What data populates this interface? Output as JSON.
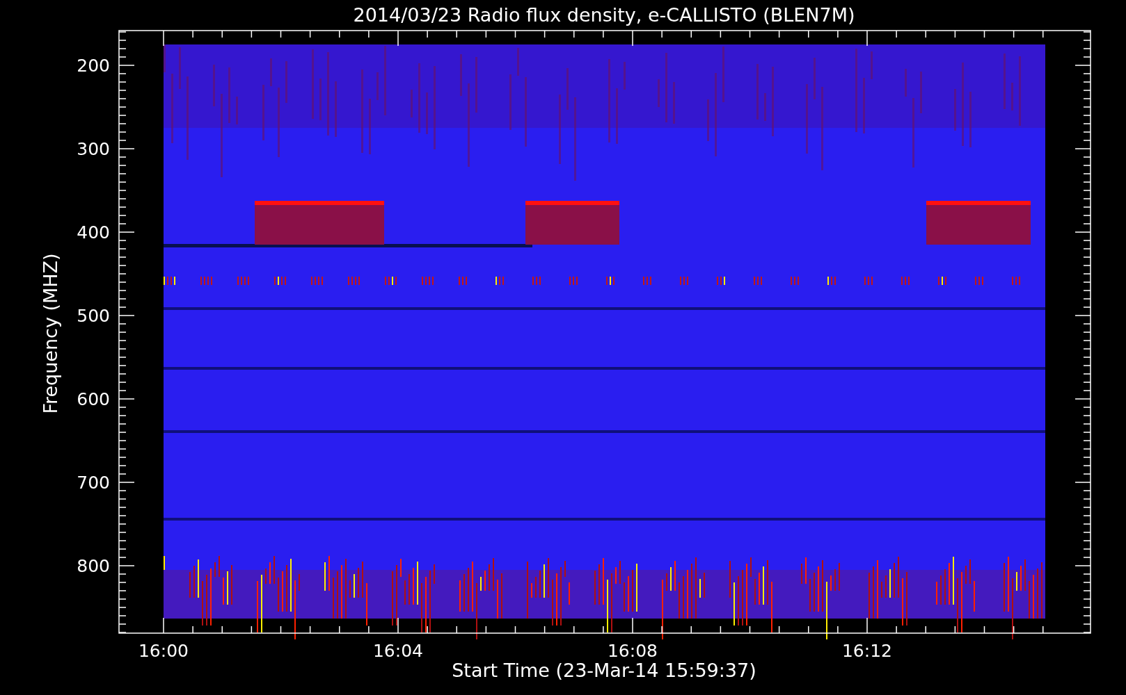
{
  "title": "2014/03/23  Radio flux density, e-CALLISTO (BLEN7M)",
  "y_axis": {
    "label": "Frequency (MHZ)",
    "ticks": [
      "200",
      "300",
      "400",
      "500",
      "600",
      "700",
      "800"
    ]
  },
  "x_axis": {
    "label": "Start Time (23-Mar-14 15:59:37)",
    "ticks": [
      "16:00",
      "16:04",
      "16:08",
      "16:12"
    ]
  }
}
